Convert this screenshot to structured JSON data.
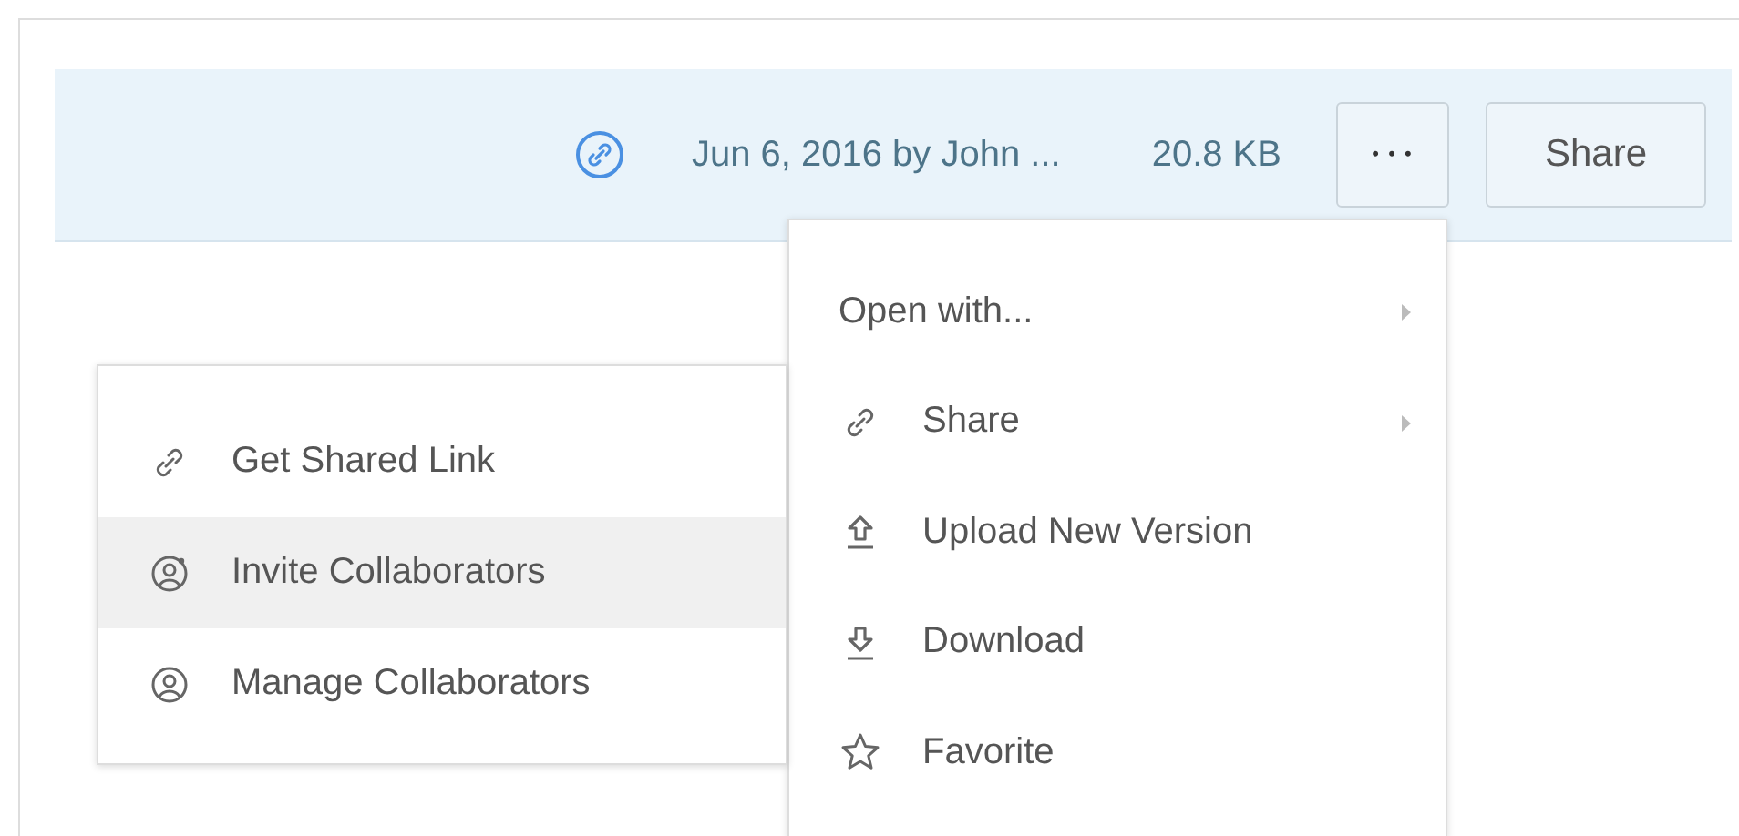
{
  "file_bar": {
    "modified": "Jun 6, 2016 by John ...",
    "size": "20.8 KB",
    "more_label": "• • •",
    "share_button": "Share"
  },
  "more_menu": {
    "items": [
      {
        "label": "Open with...",
        "has_submenu": true
      },
      {
        "label": "Share",
        "has_submenu": true
      },
      {
        "label": "Upload New Version",
        "has_submenu": false
      },
      {
        "label": "Download",
        "has_submenu": false
      },
      {
        "label": "Favorite",
        "has_submenu": false
      }
    ]
  },
  "share_submenu": {
    "items": [
      {
        "label": "Get Shared Link",
        "selected": false
      },
      {
        "label": "Invite Collaborators",
        "selected": true
      },
      {
        "label": "Manage Collaborators",
        "selected": false
      }
    ]
  }
}
